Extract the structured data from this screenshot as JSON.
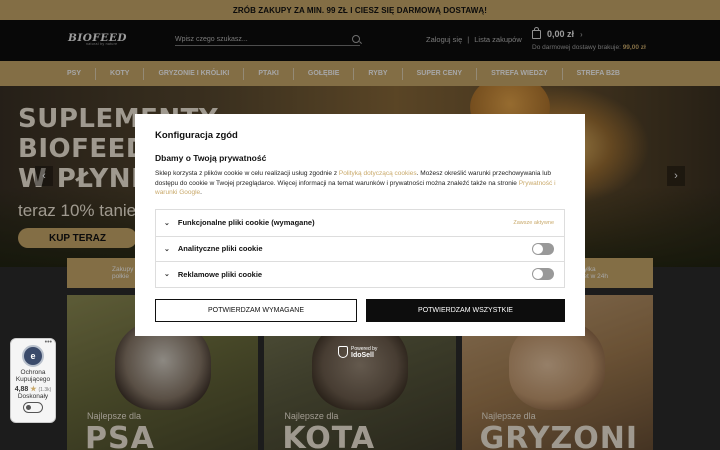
{
  "topbar": {
    "text": "ZRÓB ZAKUPY ZA MIN. 99 ZŁ I CIESZ SIĘ DARMOWĄ DOSTAWĄ!"
  },
  "header": {
    "logo": "BIOFEED",
    "logo_sub": "natural by nature",
    "search_placeholder": "Wpisz czego szukasz...",
    "login": "Zaloguj się",
    "separator": "|",
    "shopping_list": "Lista zakupów",
    "cart_total": "0,00 zł",
    "freeship_text": "Do darmowej dostawy brakuje:",
    "freeship_amount": "99,00 zł"
  },
  "nav": [
    "PSY",
    "KOTY",
    "GRYZONIE I KRÓLIKI",
    "PTAKI",
    "GOŁĘBIE",
    "RYBY",
    "SUPER CENY",
    "STREFA WIEDZY",
    "STREFA B2B"
  ],
  "hero": {
    "title_line1": "SUPLEMENTY",
    "title_line2": "BIOFEED EU",
    "title_line3": "W PŁYNIE",
    "subtitle": "teraz 10% taniej!",
    "cta": "KUP TERAZ",
    "arrow_left": "‹",
    "arrow_right": "›"
  },
  "features": {
    "left": "Zakupy\npołkie",
    "right": "Wysyłka\nnawet w 24h"
  },
  "categories": [
    {
      "small": "Najlepsze dla",
      "big": "PSA"
    },
    {
      "small": "Najlepsze dla",
      "big": "KOTA"
    },
    {
      "small": "Najlepsze dla",
      "big": "GRYZONI"
    }
  ],
  "idosell": {
    "small": "Powered by",
    "brand": "IdoSell"
  },
  "badge": {
    "logo_letter": "e",
    "line1": "Ochrona",
    "line2": "Kupującego",
    "score": "4,88",
    "star": "★",
    "count": "(1.3k)",
    "label": "Doskonały",
    "dots": "•••"
  },
  "modal": {
    "title": "Konfiguracja zgód",
    "subtitle": "Dbamy o Twoją prywatność",
    "text_1": "Sklep korzysta z plików cookie w celu realizacji usług zgodnie z ",
    "link_1": "Polityką dotyczącą cookies",
    "text_2": ". Możesz określić warunki przechowywania lub dostępu do cookie w Twojej przeglądarce. Więcej informacji na temat warunków i prywatności można znaleźć także na stronie ",
    "link_2": "Prywatność i warunki Google",
    "text_3": ".",
    "rows": [
      {
        "label": "Funkcjonalne pliki cookie (wymagane)",
        "status": "Zawsze aktywne"
      },
      {
        "label": "Analityczne pliki cookie"
      },
      {
        "label": "Reklamowe pliki cookie"
      }
    ],
    "btn_required": "POTWIERDZAM WYMAGANE",
    "btn_all": "POTWIERDZAM WSZYSTKIE"
  },
  "colors": {
    "accent": "#c9a96a",
    "dark": "#0d0d0d"
  },
  "icons": [
    "search-icon",
    "cart-icon",
    "chevron-down-icon",
    "shield-icon",
    "toggle-switch-icon"
  ]
}
